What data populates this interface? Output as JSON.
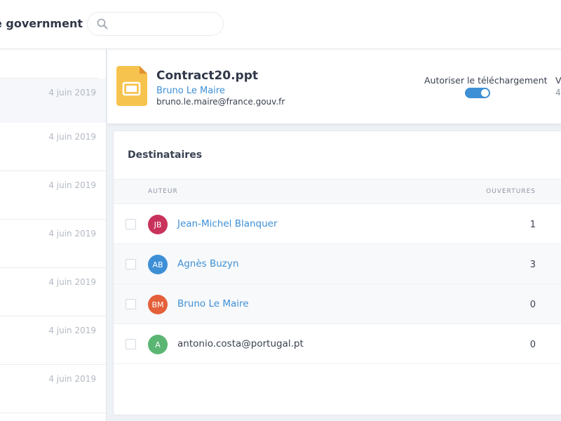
{
  "header": {
    "brand": "e government",
    "search": {
      "placeholder": "",
      "value": ""
    }
  },
  "sidebar": {
    "items": [
      {
        "date": "4 juin 2019"
      },
      {
        "date": "4 juin 2019"
      },
      {
        "date": "4 juin 2019"
      },
      {
        "date": "4 juin 2019"
      },
      {
        "date": "4 juin 2019"
      },
      {
        "date": "4 juin 2019"
      },
      {
        "date": "4 juin 2019"
      }
    ]
  },
  "file": {
    "name": "Contract20.ppt",
    "icon": "slides-file-icon",
    "icon_color": "#f7c34f",
    "owner_name": "Bruno Le Maire",
    "owner_email": "bruno.le.maire@france.gouv.fr",
    "download_label": "Autoriser le téléchargement",
    "download_enabled": true,
    "cut_label": "V",
    "cut_value": "4"
  },
  "recipients": {
    "title": "Destinataires",
    "columns": {
      "author": "AUTEUR",
      "opens": "OUVERTURES"
    },
    "rows": [
      {
        "initials": "JB",
        "name": "Jean-Michel Blanquer",
        "opens": "1",
        "color": "#c8325b",
        "link": true
      },
      {
        "initials": "AB",
        "name": "Agnès Buzyn",
        "opens": "3",
        "color": "#3d8fd6",
        "link": true
      },
      {
        "initials": "BM",
        "name": "Bruno Le Maire",
        "opens": "0",
        "color": "#e4603a",
        "link": true
      },
      {
        "initials": "A",
        "name": "antonio.costa@portugal.pt",
        "opens": "0",
        "color": "#5cb673",
        "link": false
      }
    ]
  },
  "colors": {
    "accent": "#3d8fd6",
    "text_dark": "#2f3747"
  }
}
